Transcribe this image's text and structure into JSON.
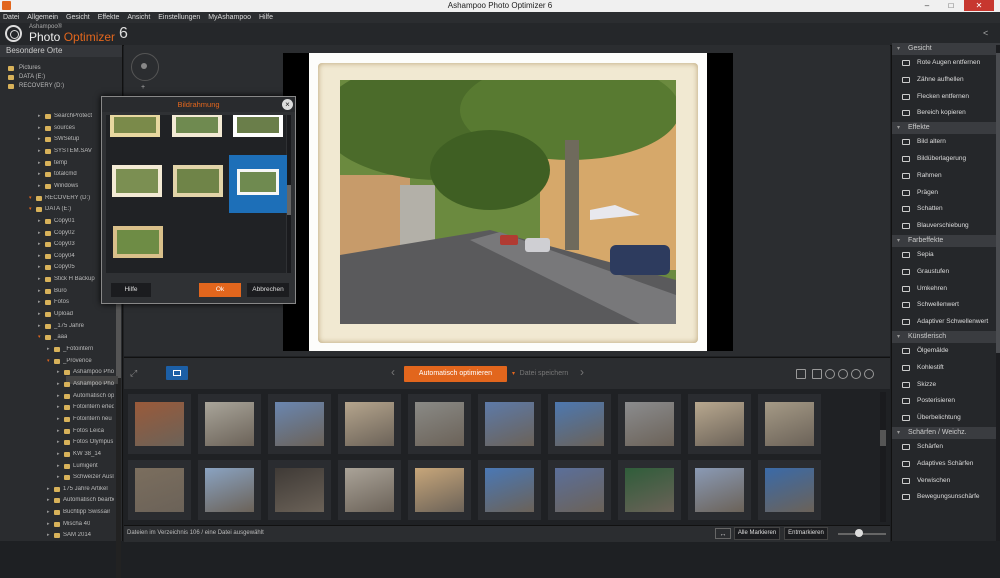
{
  "window": {
    "title": "Ashampoo Photo Optimizer 6",
    "minimize": "–",
    "maximize": "□",
    "close": "✕"
  },
  "menu": [
    "Datei",
    "Allgemein",
    "Gesicht",
    "Effekte",
    "Ansicht",
    "Einstellungen",
    "MyAshampoo",
    "Hilfe"
  ],
  "brand": {
    "small": "Ashampoo®",
    "photo": "Photo",
    "optimizer": "Optimizer",
    "version": "6"
  },
  "left_panel": {
    "header": "Besondere Orte",
    "favorites": [
      "Pictures",
      "DATA (E:)",
      "RECOVERY (D:)"
    ],
    "tree": [
      {
        "label": "SearchProtect",
        "lvl": 3
      },
      {
        "label": "sources",
        "lvl": 3
      },
      {
        "label": "SWSetup",
        "lvl": 3
      },
      {
        "label": "SYSTEM.SAV",
        "lvl": 3
      },
      {
        "label": "temp",
        "lvl": 3
      },
      {
        "label": "totalcmd",
        "lvl": 3
      },
      {
        "label": "Windows",
        "lvl": 3
      },
      {
        "label": "RECOVERY (D:)",
        "lvl": 2
      },
      {
        "label": "DATA (E:)",
        "lvl": 2
      },
      {
        "label": "Copy01",
        "lvl": 3
      },
      {
        "label": "Copy02",
        "lvl": 3
      },
      {
        "label": "Copy03",
        "lvl": 3
      },
      {
        "label": "Copy04",
        "lvl": 3
      },
      {
        "label": "Copy05",
        "lvl": 3
      },
      {
        "label": "Stick H Backup",
        "lvl": 3
      },
      {
        "label": "Büro",
        "lvl": 3
      },
      {
        "label": "Fotos",
        "lvl": 3
      },
      {
        "label": "Upload",
        "lvl": 3
      },
      {
        "label": "_175 Jahre",
        "lvl": 3
      },
      {
        "label": "_aaa",
        "lvl": 3
      },
      {
        "label": "_Fotointern",
        "lvl": 4
      },
      {
        "label": "_Provence",
        "lvl": 4
      },
      {
        "label": "Ashampoo Photo",
        "lvl": 5
      },
      {
        "label": "Ashampoo Photo",
        "lvl": 5
      },
      {
        "label": "Automatisch opti",
        "lvl": 5
      },
      {
        "label": "Fotointern erledi",
        "lvl": 5
      },
      {
        "label": "Fotointern neu",
        "lvl": 5
      },
      {
        "label": "Fotos Leica",
        "lvl": 5
      },
      {
        "label": "Fotos Olympus",
        "lvl": 5
      },
      {
        "label": "KW 38_14",
        "lvl": 5
      },
      {
        "label": "Lumigent",
        "lvl": 5
      },
      {
        "label": "Schweizer Auslan",
        "lvl": 5
      },
      {
        "label": "175 Jahre Artikel",
        "lvl": 4
      },
      {
        "label": "Automatisch bearbeit",
        "lvl": 4
      },
      {
        "label": "Buchtipp Swissair",
        "lvl": 4
      },
      {
        "label": "Mischa 40",
        "lvl": 4
      },
      {
        "label": "SAM 2014",
        "lvl": 4
      }
    ]
  },
  "right_panel": {
    "sections": [
      {
        "title": "Gesicht",
        "items": [
          {
            "label": "Rote Augen entfernen",
            "icon": "eye-icon"
          },
          {
            "label": "Zähne aufhellen",
            "icon": "tooth-icon"
          },
          {
            "label": "Flecken entfernen",
            "icon": "target-icon"
          },
          {
            "label": "Bereich kopieren",
            "icon": "copy-area-icon"
          }
        ]
      },
      {
        "title": "Effekte",
        "items": [
          {
            "label": "Bild altern",
            "icon": "age-icon"
          },
          {
            "label": "Bildüberlagerung",
            "icon": "overlay-icon"
          },
          {
            "label": "Rahmen",
            "icon": "frame-icon"
          },
          {
            "label": "Prägen",
            "icon": "emboss-icon"
          },
          {
            "label": "Schatten",
            "icon": "glasses-icon"
          },
          {
            "label": "Blauverschiebung",
            "icon": "blueshift-icon"
          }
        ]
      },
      {
        "title": "Farbeffekte",
        "items": [
          {
            "label": "Sepia",
            "icon": "sepia-icon"
          },
          {
            "label": "Graustufen",
            "icon": "grayscale-icon"
          },
          {
            "label": "Umkehren",
            "icon": "invert-icon"
          },
          {
            "label": "Schwellenwert",
            "icon": "threshold-icon"
          },
          {
            "label": "Adaptiver Schwellenwert",
            "icon": "adaptive-threshold-icon"
          }
        ]
      },
      {
        "title": "Künstlerisch",
        "items": [
          {
            "label": "Ölgemälde",
            "icon": "brush-icon"
          },
          {
            "label": "Kohlestift",
            "icon": "pencil-icon"
          },
          {
            "label": "Skizze",
            "icon": "sketch-icon"
          },
          {
            "label": "Posterisieren",
            "icon": "poster-icon"
          },
          {
            "label": "Überbelichtung",
            "icon": "exposure-icon"
          }
        ]
      },
      {
        "title": "Schärfen / Weichz.",
        "items": [
          {
            "label": "Schärfen",
            "icon": "sharpen-icon"
          },
          {
            "label": "Adaptives Schärfen",
            "icon": "adaptive-sharpen-icon"
          },
          {
            "label": "Verwischen",
            "icon": "blur-icon"
          },
          {
            "label": "Bewegungsunschärfe",
            "icon": "motion-blur-icon"
          }
        ]
      }
    ]
  },
  "toolbar": {
    "auto_optimize": "Automatisch optimieren",
    "save_file": "Datei speichern"
  },
  "dialog": {
    "title": "Bildrahmung",
    "help": "Hilfe",
    "ok": "Ok",
    "cancel": "Abbrechen"
  },
  "status": {
    "text": "Dateien im Verzeichnis 106 / eine Datei ausgewählt",
    "mark_all": "Alle Markieren",
    "unmark": "Entmarkieren"
  },
  "colors": {
    "accent": "#e2661d",
    "selection": "#1d6fb8",
    "background": "#1e2023"
  }
}
